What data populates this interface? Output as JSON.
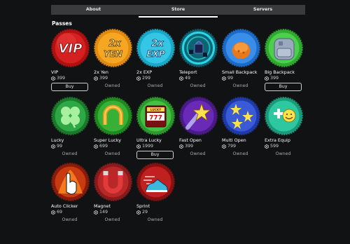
{
  "tabs": [
    {
      "label": "About",
      "active": false
    },
    {
      "label": "Store",
      "active": true
    },
    {
      "label": "Servers",
      "active": false
    }
  ],
  "section": {
    "title": "Passes"
  },
  "passes": [
    {
      "name": "VIP",
      "price": "399",
      "status": "Buy",
      "icon": "vip-icon"
    },
    {
      "name": "2x Yen",
      "price": "399",
      "status": "Owned",
      "icon": "2x-yen-icon"
    },
    {
      "name": "2x EXP",
      "price": "299",
      "status": "Owned",
      "icon": "2x-exp-icon"
    },
    {
      "name": "Teleport",
      "price": "49",
      "status": "Owned",
      "icon": "teleport-icon"
    },
    {
      "name": "Small Backpack",
      "price": "99",
      "status": "Owned",
      "icon": "small-backpack-icon"
    },
    {
      "name": "Big Backpack",
      "price": "399",
      "status": "Buy",
      "icon": "big-backpack-icon"
    },
    {
      "name": "Lucky",
      "price": "99",
      "status": "Owned",
      "icon": "clover-icon"
    },
    {
      "name": "Super Lucky",
      "price": "699",
      "status": "Owned",
      "icon": "horseshoe-icon"
    },
    {
      "name": "Ultra Lucky",
      "price": "1999",
      "status": "Buy",
      "icon": "slot-machine-icon"
    },
    {
      "name": "Fast Open",
      "price": "399",
      "status": "Owned",
      "icon": "fast-open-star-icon"
    },
    {
      "name": "Multi Open",
      "price": "799",
      "status": "Owned",
      "icon": "multi-open-stars-icon"
    },
    {
      "name": "Extra Equip",
      "price": "599",
      "status": "Owned",
      "icon": "extra-equip-icon"
    },
    {
      "name": "Auto Clicker",
      "price": "69",
      "status": "Owned",
      "icon": "auto-clicker-hand-icon"
    },
    {
      "name": "Magnet",
      "price": "149",
      "status": "Owned",
      "icon": "magnet-icon"
    },
    {
      "name": "Sprint",
      "price": "29",
      "status": "Owned",
      "icon": "sprint-shoe-icon"
    }
  ],
  "icon_text": {
    "vip": "VIP",
    "yen_top": "2x",
    "yen_bottom": "YEN",
    "exp_top": "2x",
    "exp_bottom": "EXP",
    "slot_label": "LUCKY",
    "slot_digits": "777"
  },
  "colors": {
    "background": "#111214",
    "tab_bar": "#393b3d",
    "button_border": "#cfd0d1",
    "owned_text": "#a8a9aa"
  }
}
